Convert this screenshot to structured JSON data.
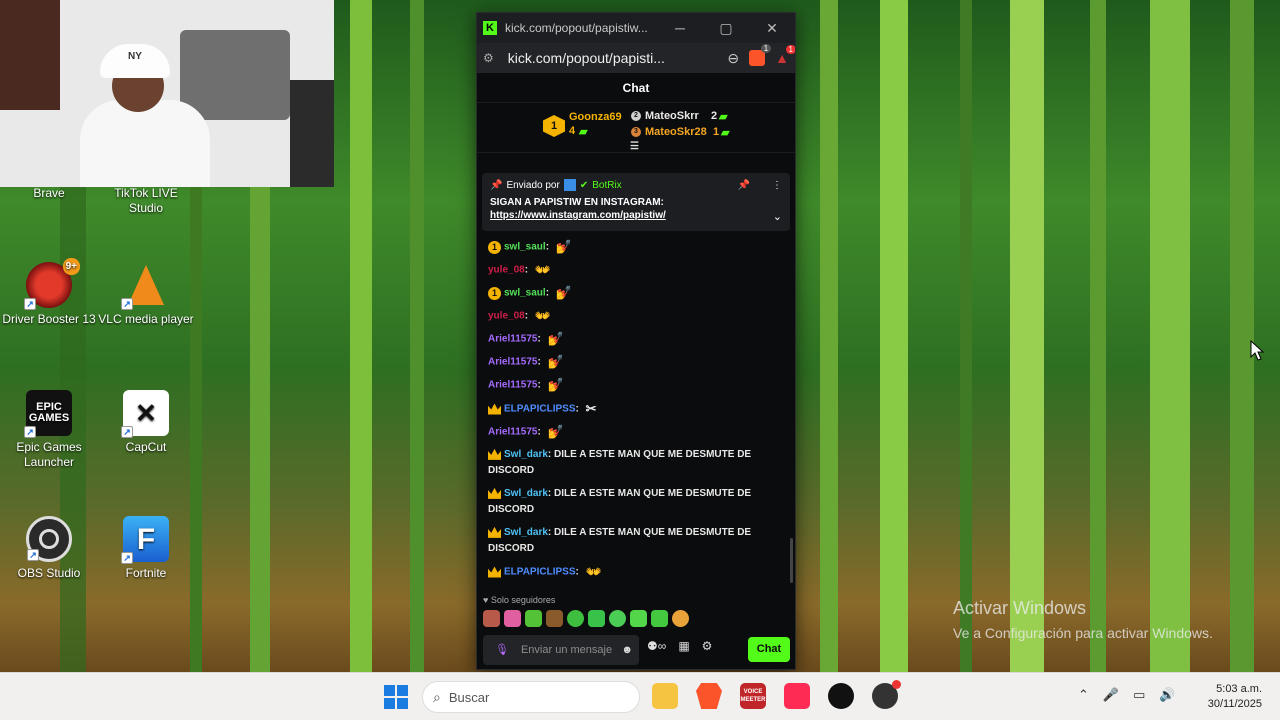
{
  "desktop": {
    "icons": [
      {
        "label": "Brave",
        "icon": "brave-icon"
      },
      {
        "label": "TikTok LIVE Studio",
        "icon": "tiktok-live-icon"
      },
      {
        "label": "Driver Booster 13",
        "icon": "driver-booster-icon",
        "badge": "9+"
      },
      {
        "label": "VLC media player",
        "icon": "vlc-icon"
      },
      {
        "label": "Epic Games Launcher",
        "icon": "epic-games-icon",
        "logo_text": "EPIC GAMES"
      },
      {
        "label": "CapCut",
        "icon": "capcut-icon"
      },
      {
        "label": "OBS Studio",
        "icon": "obs-icon"
      },
      {
        "label": "Fortnite",
        "icon": "fortnite-icon",
        "logo_text": "F"
      }
    ],
    "watermark": {
      "title": "Activar Windows",
      "subtitle": "Ve a Configuración para activar Windows."
    },
    "webcam_cap_text": "NY"
  },
  "browser": {
    "title": "kick.com/popout/papistiw...",
    "url": "kick.com/popout/papisti...",
    "brave_badge": "1",
    "alert_badge": "1",
    "controls": {
      "minimize": "─",
      "maximize": "▢",
      "close": "✕"
    }
  },
  "chat": {
    "header": "Chat",
    "leaderboard": [
      {
        "rank": "1",
        "name": "Goonza69",
        "count": "4"
      },
      {
        "rank": "2",
        "name": "MateoSkrr",
        "count": "2"
      },
      {
        "rank": "3",
        "name": "MateoSkr28",
        "count": "1"
      }
    ],
    "pinned": {
      "sent_by_label": "Enviado por",
      "sent_by": "BotRix",
      "text": "SIGAN A PAPISTIW EN INSTAGRAM:",
      "link": "https://www.instagram.com/papistiw/"
    },
    "messages": [
      {
        "user": "swl_saul",
        "color": "#55e05a",
        "badge": "1",
        "text": "",
        "emote": "💅"
      },
      {
        "user": "yule_08",
        "color": "#d01f4a",
        "badge": "",
        "text": "",
        "emote": "👐"
      },
      {
        "user": "swl_saul",
        "color": "#55e05a",
        "badge": "1",
        "text": "",
        "emote": "💅"
      },
      {
        "user": "yule_08",
        "color": "#d01f4a",
        "badge": "",
        "text": "",
        "emote": "👐"
      },
      {
        "user": "Ariel11575",
        "color": "#a56bff",
        "badge": "",
        "text": "",
        "emote": "💅"
      },
      {
        "user": "Ariel11575",
        "color": "#a56bff",
        "badge": "",
        "text": "",
        "emote": "💅"
      },
      {
        "user": "Ariel11575",
        "color": "#a56bff",
        "badge": "",
        "text": "",
        "emote": "💅"
      },
      {
        "user": "ELPAPICLIPSS",
        "color": "#4f8dff",
        "badge": "crown",
        "text": "",
        "emote": "✂"
      },
      {
        "user": "Ariel11575",
        "color": "#a56bff",
        "badge": "",
        "text": "",
        "emote": "💅"
      },
      {
        "user": "Swl_dark",
        "color": "#4fc3f7",
        "badge": "crown",
        "text": "DILE A ESTE MAN QUE ME DESMUTE DE DISCORD",
        "emote": ""
      },
      {
        "user": "Swl_dark",
        "color": "#4fc3f7",
        "badge": "crown",
        "text": "DILE A ESTE MAN QUE ME DESMUTE DE DISCORD",
        "emote": ""
      },
      {
        "user": "Swl_dark",
        "color": "#4fc3f7",
        "badge": "crown",
        "text": "DILE A ESTE MAN QUE ME DESMUTE DE DISCORD",
        "emote": ""
      },
      {
        "user": "ELPAPICLIPSS",
        "color": "#4f8dff",
        "badge": "crown",
        "text": "",
        "emote": "👐"
      }
    ],
    "followers_only": "Solo seguidores",
    "input_placeholder": "Enviar un mensaje",
    "send_button": "Chat"
  },
  "taskbar": {
    "search_placeholder": "Buscar",
    "voicemeeter_label": "VOICE MEETER",
    "time": "5:03 a.m.",
    "date": "30/11/2025"
  }
}
